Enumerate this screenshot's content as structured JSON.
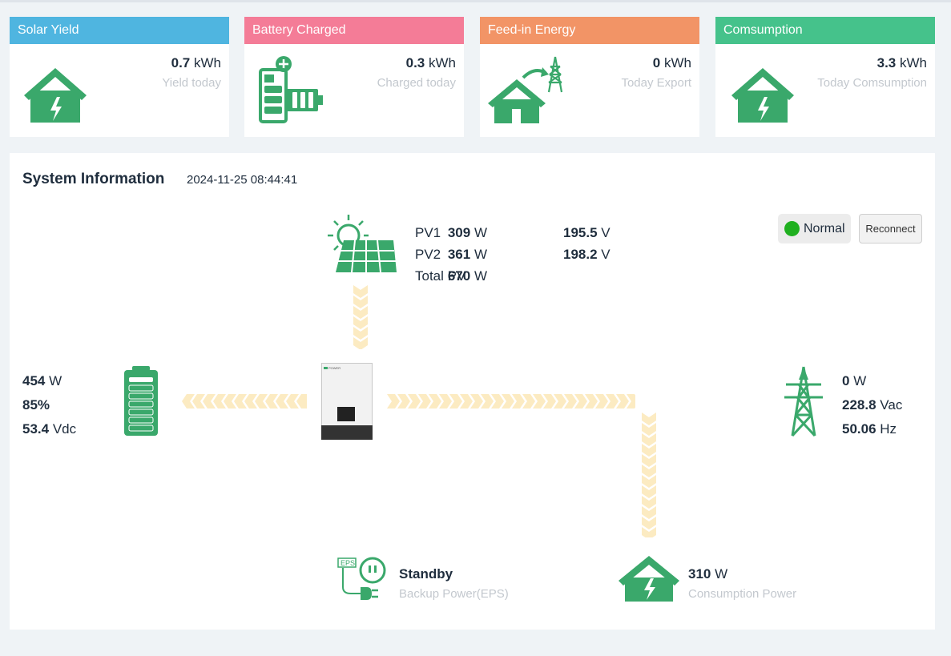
{
  "cards": [
    {
      "title": "Solar Yield",
      "value": "0.7",
      "unit": "kWh",
      "sub": "Yield today",
      "color": "#4fb5e0",
      "icon": "house-bolt-icon"
    },
    {
      "title": "Battery Charged",
      "value": "0.3",
      "unit": "kWh",
      "sub": "Charged today",
      "color": "#f47c97",
      "icon": "battery-plus-icon"
    },
    {
      "title": "Feed-in Energy",
      "value": "0",
      "unit": "kWh",
      "sub": "Today Export",
      "color": "#f29466",
      "icon": "house-tower-export-icon"
    },
    {
      "title": "Comsumption",
      "value": "3.3",
      "unit": "kWh",
      "sub": "Today Comsumption",
      "color": "#45c28b",
      "icon": "house-bolt-icon"
    }
  ],
  "system": {
    "title": "System Information",
    "timestamp": "2024-11-25 08:44:41",
    "status": "Normal",
    "status_color": "#20b020",
    "reconnect_label": "Reconnect"
  },
  "pv": {
    "rows": [
      {
        "label": "PV1",
        "power": "309",
        "power_unit": "W",
        "voltage": "195.5",
        "voltage_unit": "V"
      },
      {
        "label": "PV2",
        "power": "361",
        "power_unit": "W",
        "voltage": "198.2",
        "voltage_unit": "V"
      },
      {
        "label": "Total PV",
        "power": "670",
        "power_unit": "W",
        "voltage": "",
        "voltage_unit": ""
      }
    ]
  },
  "battery": {
    "power": "454",
    "power_unit": "W",
    "soc": "85%",
    "voltage": "53.4",
    "voltage_unit": "Vdc"
  },
  "grid": {
    "power": "0",
    "power_unit": "W",
    "voltage": "228.8",
    "voltage_unit": "Vac",
    "frequency": "50.06",
    "frequency_unit": "Hz"
  },
  "eps": {
    "status": "Standby",
    "label": "Backup Power(EPS)",
    "icon_label": "EPS"
  },
  "load": {
    "power": "310",
    "power_unit": "W",
    "label": "Consumption Power"
  },
  "inverter": {
    "brand": "POWER"
  },
  "colors": {
    "green": "#3aa86b",
    "flow": "#fcebc2",
    "muted": "#c3c8ce"
  }
}
